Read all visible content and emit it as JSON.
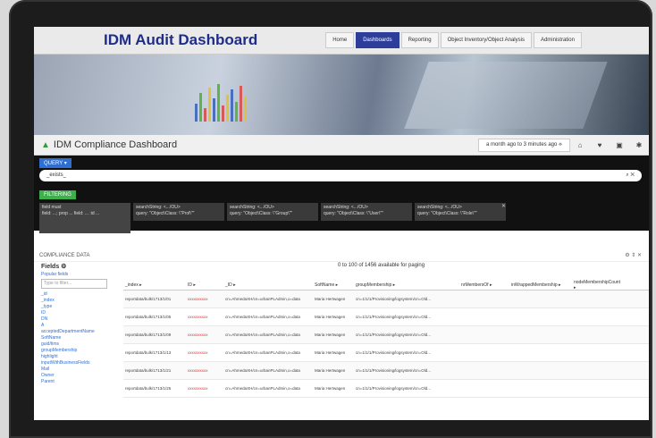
{
  "app": {
    "title": "IDM Audit Dashboard"
  },
  "nav": {
    "tabs": [
      {
        "label": "Home"
      },
      {
        "label": "Dashboards"
      },
      {
        "label": "Reporting"
      },
      {
        "label": "Object Inventory/Object Analysis"
      },
      {
        "label": "Administration"
      }
    ]
  },
  "dashboard": {
    "title": "IDM Compliance Dashboard",
    "time_range": "a month ago to 3 minutes ago ⟡"
  },
  "query": {
    "chip": "QUERY ▾",
    "value": "_exists_",
    "search_icon": "search-icon"
  },
  "filters": {
    "chip": "FILTERING",
    "panels": [
      {
        "title": "field must",
        "body": "field: ...; prop ...\nfield: ...\n:id ..."
      },
      {
        "title": "searchString: <.../OU>",
        "body": "query: \"Object\\Class: \\\"Prof\\\"\""
      },
      {
        "title": "searchString: <.../OU>",
        "body": "query: \"Object\\Class: \\\"Group\\\"\""
      },
      {
        "title": "searchString: <.../OU>",
        "body": "query: \"Object\\Class: \\\"User\\\"\""
      },
      {
        "title": "searchString: <.../OU>",
        "body": "query: \"Object\\Class: \\\"Role\\\"\""
      }
    ]
  },
  "compliance": {
    "header": "COMPLIANCE DATA",
    "fields_title": "Fields ⚙",
    "popular_label": "Popular fields",
    "filter_placeholder": "Type to filter...",
    "fields": [
      "_id",
      "_index",
      "_type",
      "ID",
      "DN",
      "A",
      "acceptedDepartmentName",
      "SoftName",
      "guid/tims",
      "groupMembership",
      "highlight",
      "inputWithBusinessFields",
      "Mail",
      "Owner",
      "Parent"
    ],
    "hit_info": "0 to 100 of 1456 available for paging",
    "columns": [
      "_index ▸",
      "ID ▸",
      "_ID ▸",
      "SoftName ▸",
      "groupMembership ▸",
      "nrMembersOf ▸",
      "inWrappedMembership ▸",
      "nodeMembershipCount ▸"
    ],
    "rows": [
      {
        "index": "reportdata/bulk/1713/1/01",
        "id": "xxxxxxxxxx",
        "uid": "cn=AhmedaXH/cn=urbanPLAdmin,o=data",
        "soft": "Maria Hertwagen",
        "group": "cn=1/1/1/Provisioning/logsystem/cn=Old..."
      },
      {
        "index": "reportdata/bulk/1713/1/05",
        "id": "xxxxxxxxxx",
        "uid": "cn=AhmedaXH/cn=urbanPLAdmin,o=data",
        "soft": "Maria Hertwagen",
        "group": "cn=1/1/1/Provisioning/logsystem/cn=Old..."
      },
      {
        "index": "reportdata/bulk/1713/1/09",
        "id": "xxxxxxxxxx",
        "uid": "cn=AhmedaXH/cn=urbanPLAdmin,o=data",
        "soft": "Maria Hertwagen",
        "group": "cn=1/1/1/Provisioning/logsystem/cn=Old..."
      },
      {
        "index": "reportdata/bulk/1713/1/13",
        "id": "xxxxxxxxxx",
        "uid": "cn=AhmedaXH/cn=urbanPLAdmin,o=data",
        "soft": "Maria Hertwagen",
        "group": "cn=1/1/1/Provisioning/logsystem/cn=Old..."
      },
      {
        "index": "reportdata/bulk/1713/1/21",
        "id": "xxxxxxxxxx",
        "uid": "cn=AhmedaXH/cn=urbanPLAdmin,o=data",
        "soft": "Maria Hertwagen",
        "group": "cn=1/1/1/Provisioning/logsystem/cn=Old..."
      },
      {
        "index": "reportdata/bulk/1713/1/25",
        "id": "xxxxxxxxxx",
        "uid": "cn=AhmedaXH/cn=urbanPLAdmin,o=data",
        "soft": "Maria Hertwagen",
        "group": "cn=1/1/1/Provisioning/logsystem/cn=Old..."
      }
    ]
  },
  "colors": {
    "brand": "#1f2d8a",
    "query_chip": "#2f6fd1",
    "filter_chip": "#3cb04a"
  }
}
